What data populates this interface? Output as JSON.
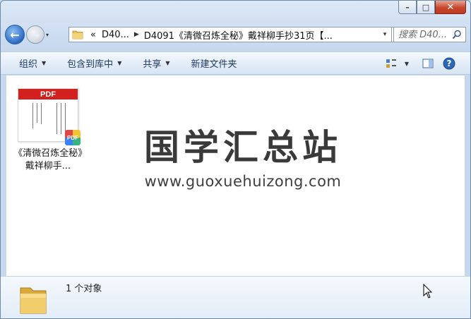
{
  "window": {
    "caption": {
      "minimize": "–",
      "maximize": "□",
      "close": "✕"
    }
  },
  "nav": {
    "back_glyph": "←",
    "forward_glyph": "→",
    "dropdown_glyph": "▾",
    "breadcrumb": {
      "overflow": "«",
      "items": [
        "D40...",
        "D4091《清微召炼全秘》戴祥柳手抄31页【..."
      ]
    },
    "refresh_glyph": "⟳",
    "search_placeholder": "搜索 D40..."
  },
  "toolbar": {
    "items": [
      {
        "label": "组织",
        "dropdown": true
      },
      {
        "label": "包含到库中",
        "dropdown": true
      },
      {
        "label": "共享",
        "dropdown": true
      },
      {
        "label": "新建文件夹",
        "dropdown": false
      }
    ],
    "help_glyph": "?"
  },
  "content": {
    "files": [
      {
        "thumb_header": "PDF",
        "badge": "PDF",
        "label": "《清微召炼全秘》戴祥柳手..."
      }
    ],
    "watermark": {
      "title": "国学汇总站",
      "url": "www.guoxuehuizong.com"
    }
  },
  "details": {
    "count_text": "1 个对象"
  },
  "colors": {
    "pdf_red": "#d2201f",
    "toolbar_text": "#1e3a5f",
    "close_button": "#c7462c"
  }
}
